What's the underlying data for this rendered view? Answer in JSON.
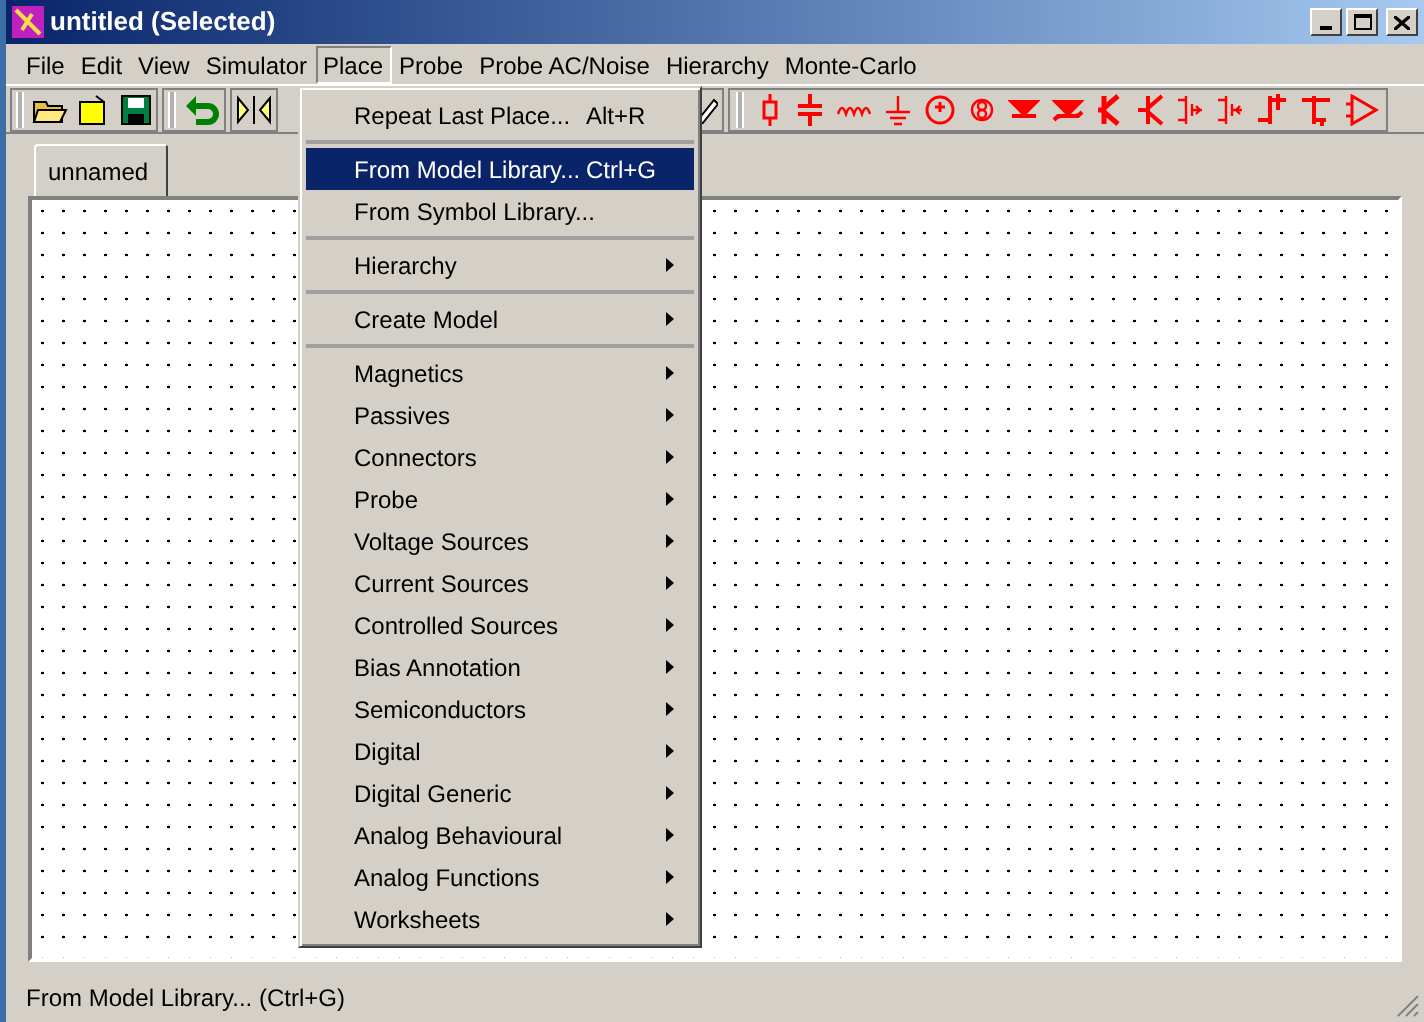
{
  "window": {
    "title": "untitled (Selected)"
  },
  "menu_bar": [
    {
      "label": "File",
      "selected": false
    },
    {
      "label": "Edit",
      "selected": false
    },
    {
      "label": "View",
      "selected": false
    },
    {
      "label": "Simulator",
      "selected": false
    },
    {
      "label": "Place",
      "selected": true
    },
    {
      "label": "Probe",
      "selected": false
    },
    {
      "label": "Probe AC/Noise",
      "selected": false
    },
    {
      "label": "Hierarchy",
      "selected": false
    },
    {
      "label": "Monte-Carlo",
      "selected": false
    }
  ],
  "tabs": [
    {
      "label": "unnamed",
      "selected": true
    }
  ],
  "place_menu": [
    {
      "label": "Repeat Last Place...",
      "shortcut": "Alt+R",
      "submenu": false,
      "separator_after": true,
      "selected": false
    },
    {
      "label": "From Model Library...",
      "shortcut": "Ctrl+G",
      "submenu": false,
      "separator_after": false,
      "selected": true
    },
    {
      "label": "From Symbol Library...",
      "submenu": false,
      "separator_after": true,
      "selected": false
    },
    {
      "label": "Hierarchy",
      "submenu": true,
      "separator_after": true,
      "selected": false
    },
    {
      "label": "Create Model",
      "submenu": true,
      "separator_after": true,
      "selected": false
    },
    {
      "label": "Magnetics",
      "submenu": true,
      "separator_after": false,
      "selected": false
    },
    {
      "label": "Passives",
      "submenu": true,
      "separator_after": false,
      "selected": false
    },
    {
      "label": "Connectors",
      "submenu": true,
      "separator_after": false,
      "selected": false
    },
    {
      "label": "Probe",
      "submenu": true,
      "separator_after": false,
      "selected": false
    },
    {
      "label": "Voltage Sources",
      "submenu": true,
      "separator_after": false,
      "selected": false
    },
    {
      "label": "Current Sources",
      "submenu": true,
      "separator_after": false,
      "selected": false
    },
    {
      "label": "Controlled Sources",
      "submenu": true,
      "separator_after": false,
      "selected": false
    },
    {
      "label": "Bias Annotation",
      "submenu": true,
      "separator_after": false,
      "selected": false
    },
    {
      "label": "Semiconductors",
      "submenu": true,
      "separator_after": false,
      "selected": false
    },
    {
      "label": "Digital",
      "submenu": true,
      "separator_after": false,
      "selected": false
    },
    {
      "label": "Digital Generic",
      "submenu": true,
      "separator_after": false,
      "selected": false
    },
    {
      "label": "Analog Behavioural",
      "submenu": true,
      "separator_after": false,
      "selected": false
    },
    {
      "label": "Analog Functions",
      "submenu": true,
      "separator_after": false,
      "selected": false
    },
    {
      "label": "Worksheets",
      "submenu": true,
      "separator_after": false,
      "selected": false
    }
  ],
  "status_bar": {
    "text": "From Model Library... (Ctrl+G)"
  }
}
